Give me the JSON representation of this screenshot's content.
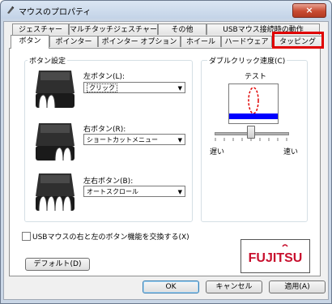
{
  "window": {
    "title": "マウスのプロパティ",
    "close_label": "×"
  },
  "tabs_back_row": [
    "ジェスチャー",
    "マルチタッチジェスチャー",
    "その他",
    "USBマウス接続時の動作"
  ],
  "tabs_front_row": [
    "ボタン",
    "ポインター",
    "ポインター オプション",
    "ホイール",
    "ハードウェア",
    "タッピング"
  ],
  "active_tab": "ボタン",
  "button_settings": {
    "group_label": "ボタン設定",
    "left": {
      "label": "左ボタン(L):",
      "value": "クリック"
    },
    "right": {
      "label": "右ボタン(R):",
      "value": "ショートカットメニュー"
    },
    "both": {
      "label": "左右ボタン(B):",
      "value": "オートスクロール"
    }
  },
  "double_click": {
    "group_label": "ダブルクリック速度(C)",
    "test_label": "テスト",
    "slow_label": "遅い",
    "fast_label": "速い",
    "speed_level": 0.5
  },
  "swap_checkbox": {
    "label": "USBマウスの右と左のボタン機能を交換する(X)",
    "checked": false
  },
  "default_button": "デフォルト(D)",
  "logo_text": "FUJITSU",
  "footer": {
    "ok": "OK",
    "cancel": "キャンセル",
    "apply": "適用(A)"
  },
  "colors": {
    "highlight": "#e00000",
    "test_blue": "#0000ff",
    "logo_red": "#c8102e"
  }
}
